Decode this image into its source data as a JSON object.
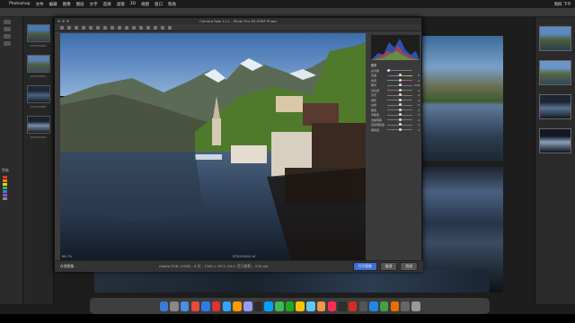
{
  "menubar": {
    "app_name": "Photoshop",
    "menus": [
      "文件",
      "编辑",
      "图像",
      "图层",
      "文字",
      "选择",
      "滤镜",
      "3D",
      "视图",
      "窗口",
      "帮助"
    ],
    "clock": "周四 下午"
  },
  "dialog": {
    "title": "Camera Raw 11.1 - Photo Pro 3D DSRP Photo",
    "status_left": "66.7%",
    "filename": "DTR200000 tif",
    "status_right": "",
    "bottom_left": "存储图像...",
    "bottom_center": "Adobe RGB (1998) - 8 位 - 7360 x 4912 (36.2 百万像素) - 240 ppi",
    "open_button": "打开图像",
    "cancel_button": "取消",
    "done_button": "完成"
  },
  "panel": {
    "section_basic": "基本",
    "rows": [
      {
        "label": "白平衡",
        "value": ""
      },
      {
        "label": "色温",
        "value": "0"
      },
      {
        "label": "色调",
        "value": "0"
      },
      {
        "label": "曝光",
        "value": "0.00"
      },
      {
        "label": "对比度",
        "value": "0"
      },
      {
        "label": "高光",
        "value": "0"
      },
      {
        "label": "阴影",
        "value": "0"
      },
      {
        "label": "白色",
        "value": "0"
      },
      {
        "label": "黑色",
        "value": "0"
      },
      {
        "label": "清晰度",
        "value": "0"
      },
      {
        "label": "去除薄雾",
        "value": "0"
      },
      {
        "label": "自然饱和度",
        "value": "0"
      },
      {
        "label": "饱和度",
        "value": "0"
      }
    ]
  },
  "filmstrip_left": {
    "labels": [
      "DTR200000",
      "DTR200001",
      "DTR200002",
      "DTR200003"
    ]
  },
  "left_panel": {
    "title": "色板"
  },
  "colors": {
    "primary_button": "#3a6fd8",
    "dialog_bg": "#3b3b3b",
    "panel_bg": "#3a3a3a"
  }
}
